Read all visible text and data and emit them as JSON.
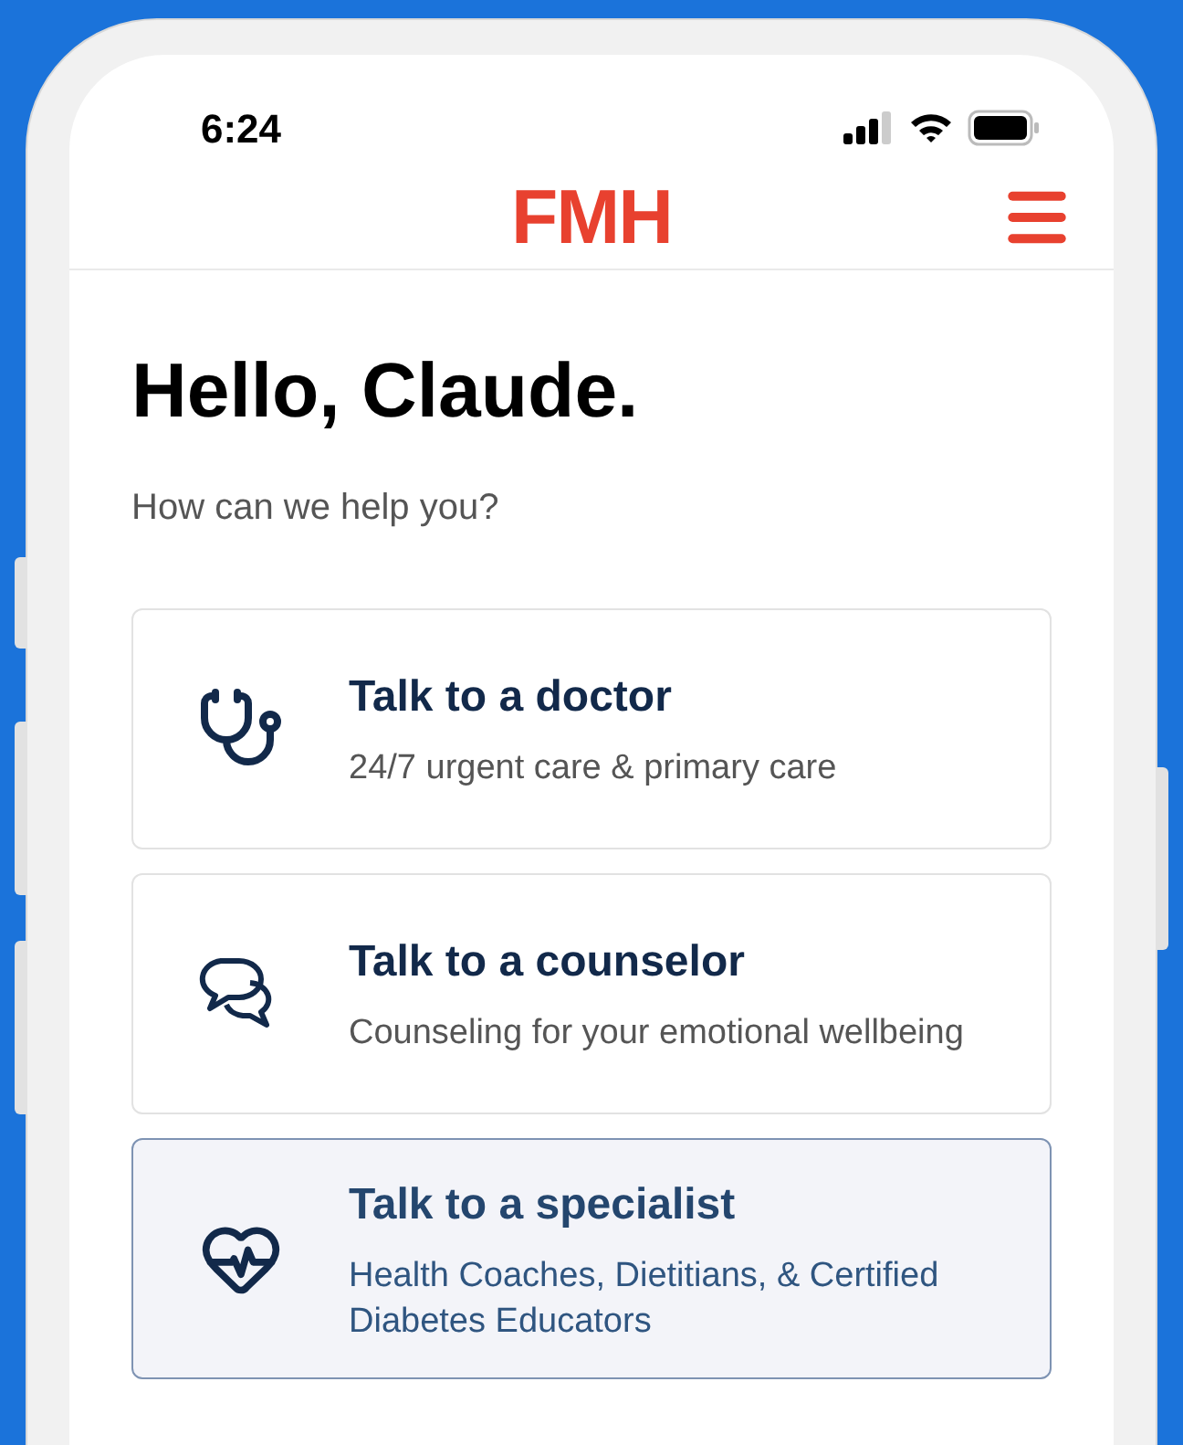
{
  "status_bar": {
    "time": "6:24"
  },
  "header": {
    "logo": "FMH"
  },
  "greeting": {
    "title": "Hello, Claude.",
    "subtitle": "How can we help you?"
  },
  "options": [
    {
      "kind": "doctor",
      "title": "Talk to a doctor",
      "description": "24/7 urgent care & primary care",
      "selected": false
    },
    {
      "kind": "counselor",
      "title": "Talk to a counselor",
      "description": "Counseling for your emotional wellbeing",
      "selected": false
    },
    {
      "kind": "specialist",
      "title": "Talk to a specialist",
      "description": "Health Coaches, Dietitians, & Certified Diabetes Educators",
      "selected": true
    }
  ]
}
